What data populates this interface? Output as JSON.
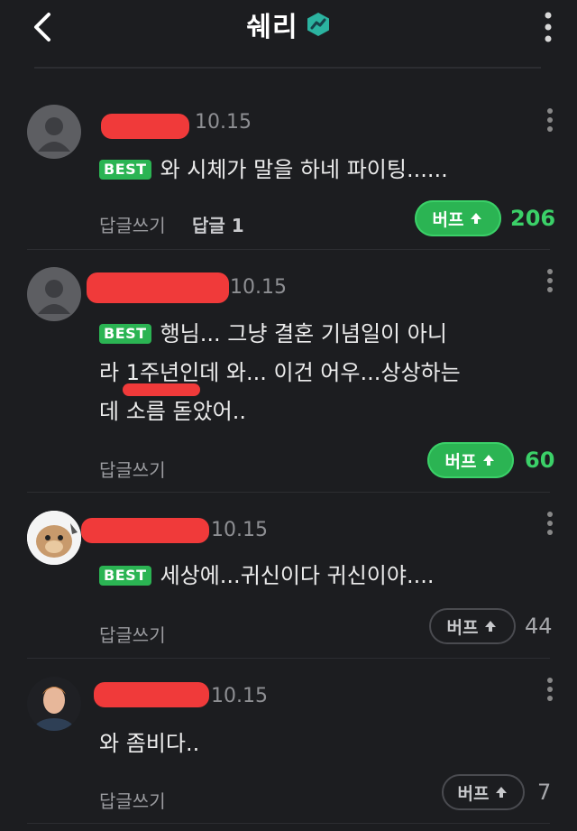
{
  "header": {
    "title": "쉐리",
    "back_icon": "chevron-left-icon",
    "badge_icon": "trend-badge-icon",
    "menu_icon": "vertical-dots-icon"
  },
  "comments": [
    {
      "author_redacted": true,
      "date": "10.15",
      "best_label": "BEST",
      "text": "와 시체가 말을 하네 파이팅......",
      "reply_label": "답글쓰기",
      "reply_count": "답글 1",
      "buff_label": "버프",
      "buff_count": "206"
    },
    {
      "author_redacted": true,
      "date": "10.15",
      "best_label": "BEST",
      "text_line1": "행님... 그냥 결혼 기념일이 아니",
      "text_line2": "라 1주년인데 와... 이건 어우...상상하는",
      "text_line3": "데 소름 돋았어..",
      "reply_label": "답글쓰기",
      "buff_label": "버프",
      "buff_count": "60"
    },
    {
      "author_redacted": true,
      "date": "10.15",
      "best_label": "BEST",
      "text": "세상에...귀신이다 귀신이야....",
      "reply_label": "답글쓰기",
      "buff_label": "버프",
      "buff_count": "44"
    },
    {
      "author_redacted": true,
      "date": "10.15",
      "text": "와 좀비다..",
      "reply_label": "답글쓰기",
      "buff_label": "버프",
      "buff_count": "7"
    }
  ],
  "colors": {
    "background": "#1c1d20",
    "accent_green": "#2bb453",
    "redaction": "#f03a3a"
  }
}
